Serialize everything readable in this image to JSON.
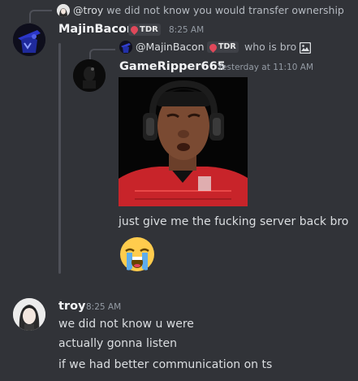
{
  "top_reply": {
    "mention": "@troy",
    "text": "we did not know you would transfer ownership"
  },
  "majin_message": {
    "username": "MajinBacon",
    "badge": "TDR",
    "timestamp": "8:25 AM"
  },
  "inner_reply": {
    "mention": "@MajinBacon",
    "badge": "TDR",
    "text": "who is bro",
    "attachment_icon": "image-icon"
  },
  "quoted_message": {
    "username": "GameRipper665",
    "timestamp": "Yesterday at 11:10 AM",
    "text": "just give me the fucking server back bro",
    "emoji": "loudly-crying-face"
  },
  "troy_message": {
    "username": "troy",
    "timestamp": "8:25 AM",
    "lines": [
      "we did not know u were",
      "actually gonna listen",
      "if we had better communication on ts"
    ]
  },
  "colors": {
    "background": "#313338",
    "username": "#f2f3f5",
    "text": "#dbdee1",
    "timestamp": "#949ba4",
    "badge_accent": "#e0485a",
    "jersey_red": "#d22a2a"
  }
}
